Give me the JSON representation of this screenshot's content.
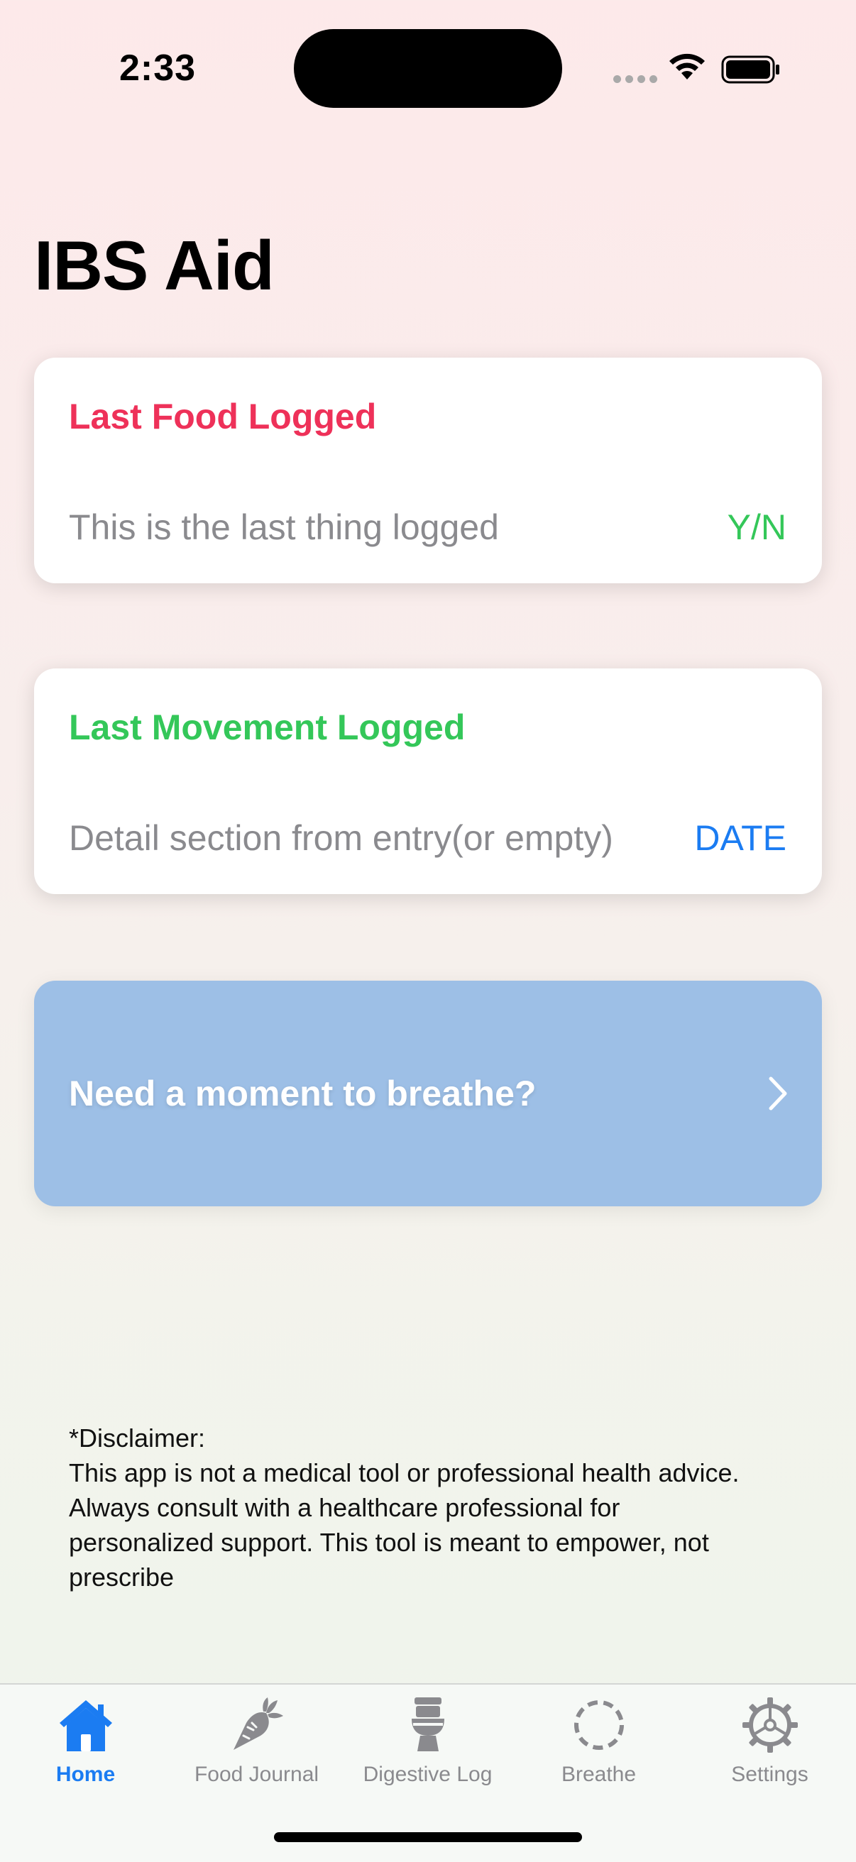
{
  "status_bar": {
    "time": "2:33"
  },
  "app_title": "IBS Aid",
  "food_card": {
    "title": "Last Food Logged",
    "detail": "This is the last thing logged",
    "right_value": "Y/N"
  },
  "movement_card": {
    "title": "Last Movement Logged",
    "detail": "Detail section from entry(or empty)",
    "right_value": "DATE"
  },
  "breathe_prompt": {
    "label": "Need a moment to breathe?",
    "icon": "chevron-right-icon"
  },
  "disclaimer": {
    "heading": "*Disclaimer:",
    "line1": "This app is not a medical tool or professional health advice.",
    "line2": "Always consult with a healthcare professional for",
    "line3": "personalized support. This tool is meant to empower, not",
    "line4": "prescribe"
  },
  "tabs": [
    {
      "label": "Home",
      "icon": "house-icon",
      "active": true
    },
    {
      "label": "Food Journal",
      "icon": "carrot-icon",
      "active": false
    },
    {
      "label": "Digestive Log",
      "icon": "toilet-icon",
      "active": false
    },
    {
      "label": "Breathe",
      "icon": "dashed-circle-icon",
      "active": false
    },
    {
      "label": "Settings",
      "icon": "gear-icon",
      "active": false
    }
  ],
  "colors": {
    "food_title": "#ee3159",
    "movement_title": "#34c759",
    "yn": "#34c759",
    "date": "#1b7cf2",
    "accent": "#1b7cf2",
    "breathe_button": "#9dbfe6"
  }
}
